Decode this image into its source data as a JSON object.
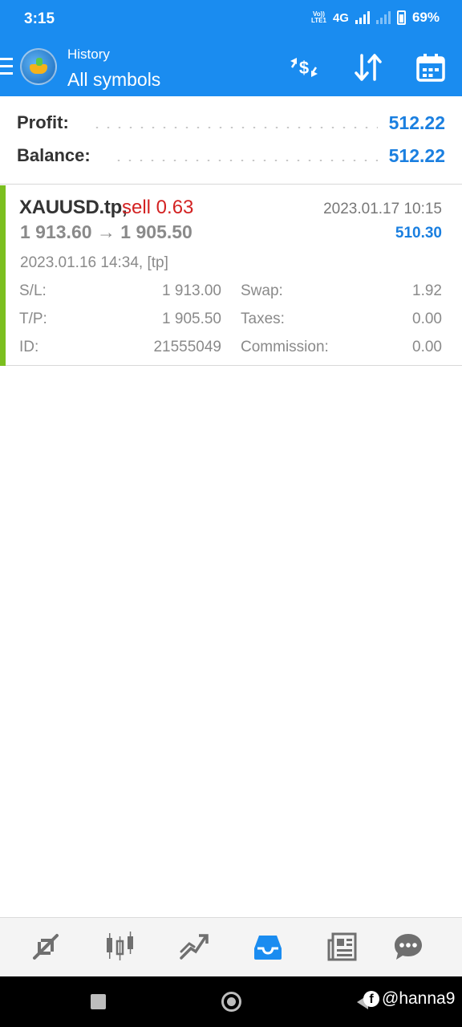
{
  "status_bar": {
    "time": "3:15",
    "volte_top": "Vo))",
    "volte_bottom": "LTE1",
    "network": "4G",
    "battery": "69%"
  },
  "header": {
    "subtitle": "History",
    "title": "All symbols",
    "accent_color": "#1a8cf0"
  },
  "summary": {
    "profit_label": "Profit:",
    "profit_value": "512.22",
    "balance_label": "Balance:",
    "balance_value": "512.22"
  },
  "trade": {
    "symbol": "XAUUSD.tp,",
    "side": "sell 0.63",
    "close_time": "2023.01.17 10:15",
    "prices": "1 913.60 → 1 905.50",
    "profit": "510.30",
    "open_time": "2023.01.16 14:34, [tp]",
    "sl_label": "S/L:",
    "sl_value": "1 913.00",
    "swap_label": "Swap:",
    "swap_value": "1.92",
    "tp_label": "T/P:",
    "tp_value": "1 905.50",
    "taxes_label": "Taxes:",
    "taxes_value": "0.00",
    "id_label": "ID:",
    "id_value": "21555049",
    "commission_label": "Commission:",
    "commission_value": "0.00",
    "side_color": "#d32222",
    "indicator_color": "#7bbf1f"
  },
  "bottom_nav": {
    "items": [
      "quotes-icon",
      "chart-icon",
      "trade-icon",
      "history-icon",
      "news-icon",
      "chat-icon"
    ],
    "active": "history-icon"
  },
  "watermark": {
    "fb": "f",
    "text": "@hanna9"
  }
}
